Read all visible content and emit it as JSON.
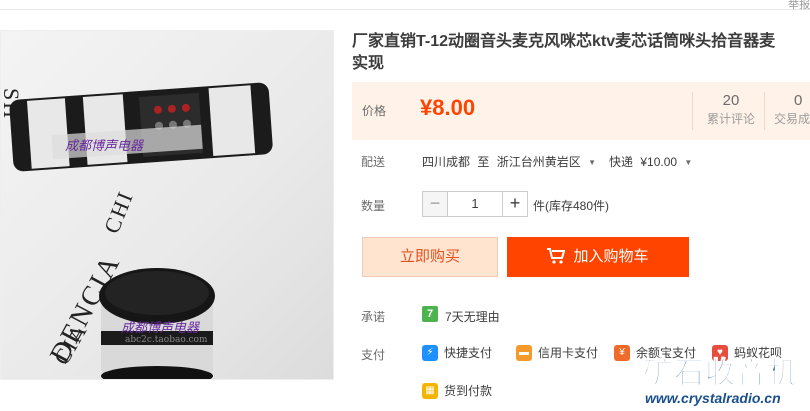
{
  "top_bar": {
    "report_text": "举报"
  },
  "image": {
    "shop_watermark_top": "成都博声电器",
    "shop_watermark_bottom": "成都博声电器",
    "shop_url_small": "abc2c.taobao.com",
    "bg_text_1": "DENCIA",
    "bg_text_2": "CIA",
    "bg_text_3": "CHI",
    "bg_text_4": "SH"
  },
  "product": {
    "title_line1": "厂家直销T-12动圈音头麦克风咪芯ktv麦芯话筒咪头拾音器麦",
    "title_line2": "实现"
  },
  "price": {
    "label": "价格",
    "value": "¥8.00",
    "reviews_count": "20",
    "reviews_label": "累计评论",
    "sales_count": "0",
    "sales_label": "交易成"
  },
  "shipping": {
    "label": "配送",
    "from": "四川成都",
    "to_word": "至",
    "to": "浙江台州黄岩区",
    "method": "快递",
    "fee": "¥10.00"
  },
  "quantity": {
    "label": "数量",
    "minus": "−",
    "value": "1",
    "plus": "+",
    "unit": "件(库存480件)"
  },
  "actions": {
    "buy_now": "立即购买",
    "add_to_cart": "加入购物车"
  },
  "promise": {
    "label": "承诺",
    "icon_text": "7",
    "text": "7天无理由"
  },
  "payment": {
    "label": "支付",
    "methods": [
      "快捷支付",
      "信用卡支付",
      "余额宝支付",
      "蚂蚁花呗",
      "货到付款"
    ]
  },
  "brand": {
    "name": "矿石收音机",
    "url": "www.crystalradio.cn"
  },
  "colors": {
    "accent": "#ff4400",
    "price": "#ff4400",
    "brand": "#1a4f8c"
  }
}
